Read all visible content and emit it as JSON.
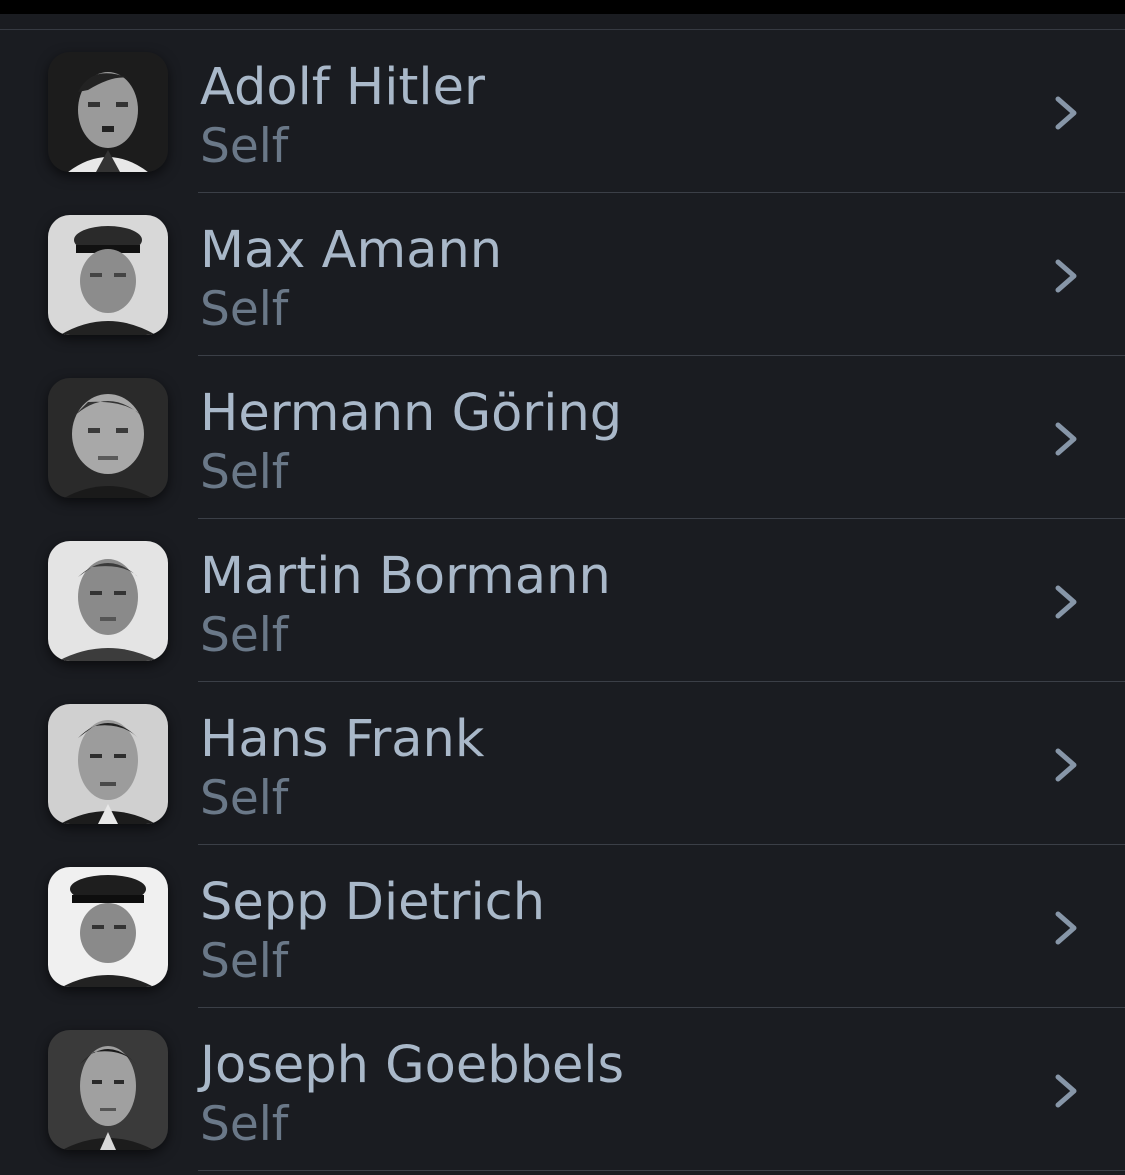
{
  "colors": {
    "background": "#1a1c21",
    "name_text": "#a9b8c9",
    "role_text": "#6a7888",
    "chevron": "#8796a8",
    "divider": "#3b3f47"
  },
  "cast": [
    {
      "name": "Adolf Hitler",
      "role": "Self",
      "icon": "person-photo-icon"
    },
    {
      "name": "Max Amann",
      "role": "Self",
      "icon": "person-photo-icon"
    },
    {
      "name": "Hermann Göring",
      "role": "Self",
      "icon": "person-photo-icon"
    },
    {
      "name": "Martin Bormann",
      "role": "Self",
      "icon": "person-photo-icon"
    },
    {
      "name": "Hans Frank",
      "role": "Self",
      "icon": "person-photo-icon"
    },
    {
      "name": "Sepp Dietrich",
      "role": "Self",
      "icon": "person-photo-icon"
    },
    {
      "name": "Joseph Goebbels",
      "role": "Self",
      "icon": "person-photo-icon"
    }
  ]
}
